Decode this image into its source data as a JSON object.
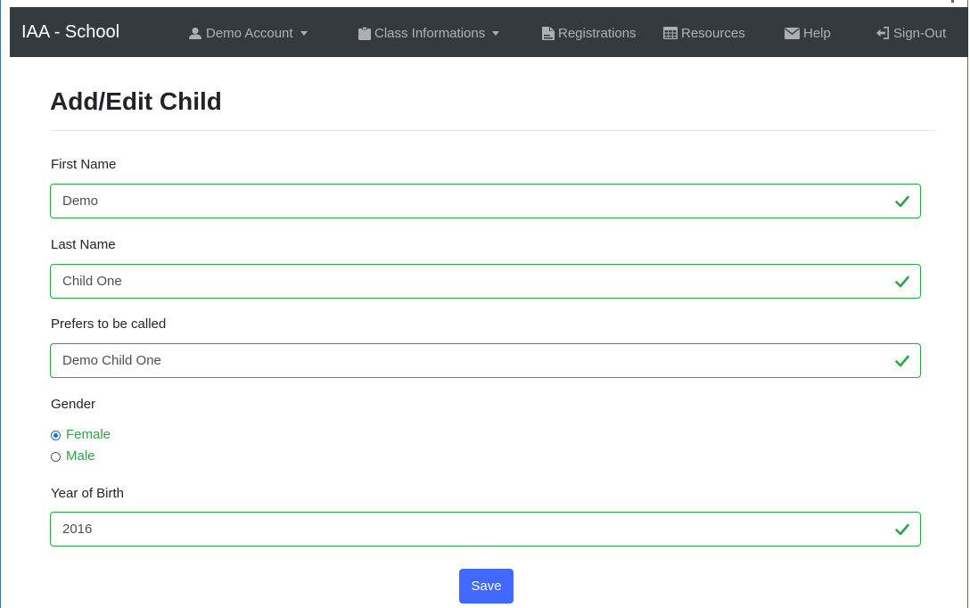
{
  "navbar": {
    "brand": "IAA - School",
    "items": [
      {
        "label": "Demo Account",
        "icon": "user-icon",
        "dropdown": true
      },
      {
        "label": "Class Informations",
        "icon": "clipboard-icon",
        "dropdown": true
      },
      {
        "label": "Registrations",
        "icon": "file-signature-icon",
        "dropdown": false
      },
      {
        "label": "Resources",
        "icon": "table-icon",
        "dropdown": false
      },
      {
        "label": "Help",
        "icon": "envelope-icon",
        "dropdown": false
      },
      {
        "label": "Sign-Out",
        "icon": "sign-out-icon",
        "dropdown": false
      }
    ]
  },
  "page": {
    "title": "Add/Edit Child"
  },
  "form": {
    "first_name": {
      "label": "First Name",
      "value": "Demo"
    },
    "last_name": {
      "label": "Last Name",
      "value": "Child One"
    },
    "preferred_name": {
      "label": "Prefers to be called",
      "value": "Demo Child One"
    },
    "gender": {
      "label": "Gender",
      "options": [
        {
          "label": "Female",
          "checked": true
        },
        {
          "label": "Male",
          "checked": false
        }
      ]
    },
    "year_of_birth": {
      "label": "Year of Birth",
      "value": "2016"
    },
    "save_label": "Save"
  },
  "colors": {
    "navbar_bg": "#343a40",
    "valid_green": "#28a745",
    "primary_button": "#4169ff"
  }
}
